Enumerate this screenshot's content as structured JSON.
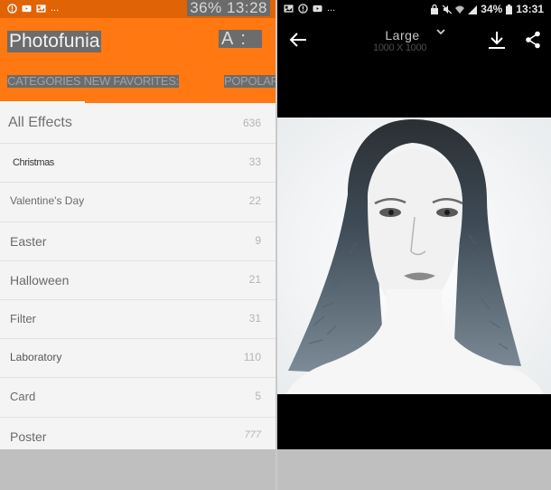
{
  "left_screen": {
    "status_bar": {
      "notification_icons": [
        "alert-icon",
        "youtube-icon",
        "image-icon"
      ],
      "overflow": "...",
      "battery_time": "36% 13:28"
    },
    "app_bar": {
      "title": "Photofunia",
      "actions": [
        "A",
        ":"
      ]
    },
    "tabs": [
      {
        "label": "CATEGORIES NEW FAVORITES:",
        "active": true
      },
      {
        "label": "POPOLAR"
      }
    ],
    "categories": [
      {
        "name": "All Effects",
        "count": "636"
      },
      {
        "name": "Christmas",
        "count": "33"
      },
      {
        "name": "Valentine's Day",
        "count": "22"
      },
      {
        "name": "Easter",
        "count": "9"
      },
      {
        "name": "Halloween",
        "count": "21"
      },
      {
        "name": "Filter",
        "count": "31"
      },
      {
        "name": "Laboratory",
        "count": "110"
      },
      {
        "name": "Card",
        "count": "5"
      },
      {
        "name": "Poster",
        "count": "777"
      }
    ]
  },
  "right_screen": {
    "status_bar": {
      "notification_icons": [
        "image-icon",
        "alert-icon",
        "youtube-icon"
      ],
      "overflow": "...",
      "battery": "34%",
      "time": "13:31"
    },
    "toolbar": {
      "size_label": "Large",
      "dimensions": "1000 X 1000"
    },
    "photo": {
      "description": "Double-exposure black and white portrait of a woman with foliage blended into her hair"
    }
  },
  "colors": {
    "accent": "#ff7812",
    "status_bar_left": "#e06306",
    "right_background": "#000000"
  }
}
